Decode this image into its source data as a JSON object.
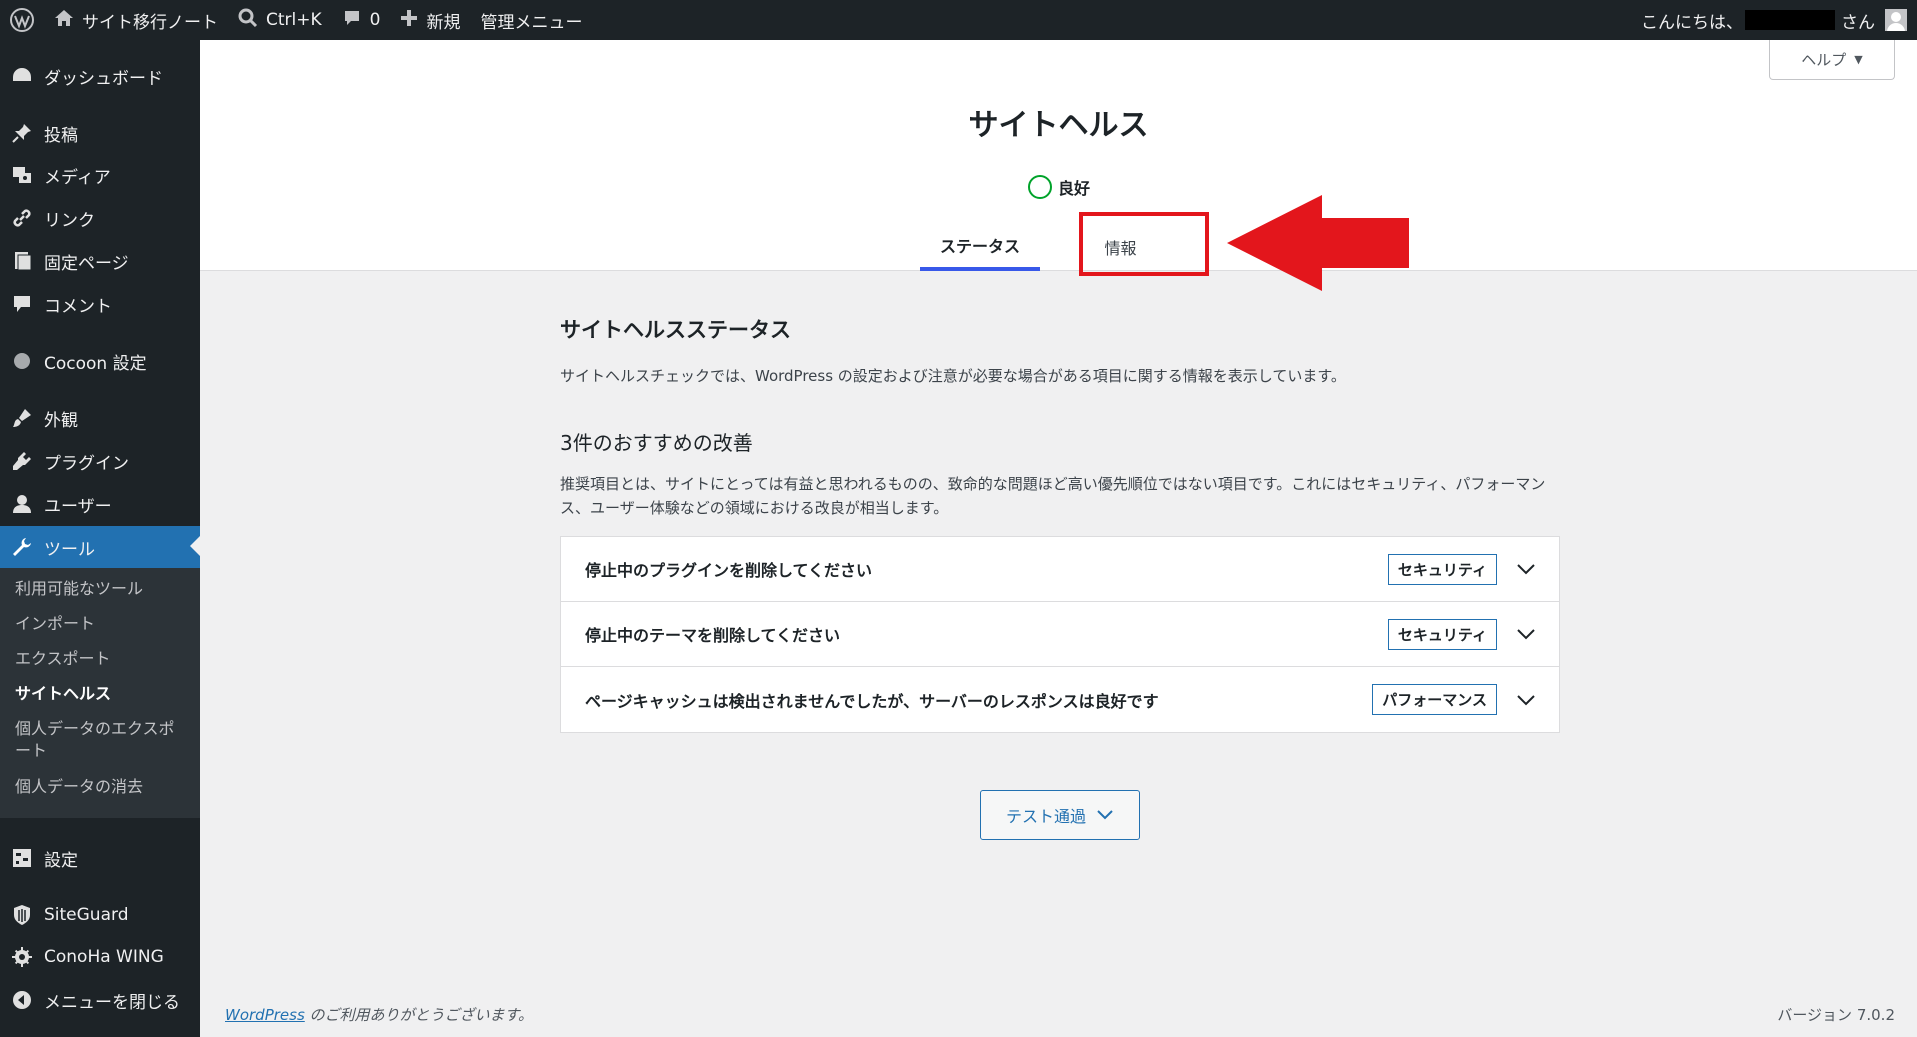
{
  "adminbar": {
    "site_name": "サイト移行ノート",
    "search_shortcut": "Ctrl+K",
    "comments_count": "0",
    "new_label": "新規",
    "admin_menu_label": "管理メニュー",
    "greeting": "こんにちは、",
    "greeting_suffix": "さん"
  },
  "sidebar": {
    "items": [
      {
        "label": "ダッシュボード",
        "icon": "dashboard-icon"
      },
      {
        "label": "投稿",
        "icon": "pin-icon"
      },
      {
        "label": "メディア",
        "icon": "media-icon"
      },
      {
        "label": "リンク",
        "icon": "link-icon"
      },
      {
        "label": "固定ページ",
        "icon": "page-icon"
      },
      {
        "label": "コメント",
        "icon": "comment-icon"
      },
      {
        "label": "Cocoon 設定",
        "icon": "circle-icon"
      },
      {
        "label": "外観",
        "icon": "brush-icon"
      },
      {
        "label": "プラグイン",
        "icon": "plugin-icon"
      },
      {
        "label": "ユーザー",
        "icon": "user-icon"
      },
      {
        "label": "ツール",
        "icon": "wrench-icon"
      },
      {
        "label": "設定",
        "icon": "settings-icon"
      },
      {
        "label": "SiteGuard",
        "icon": "shield-icon"
      },
      {
        "label": "ConoHa WING",
        "icon": "gear-icon"
      },
      {
        "label": "メニューを閉じる",
        "icon": "collapse-icon"
      }
    ],
    "submenu": [
      "利用可能なツール",
      "インポート",
      "エクスポート",
      "サイトヘルス",
      "個人データのエクスポート",
      "個人データの消去"
    ]
  },
  "header": {
    "help_label": "ヘルプ",
    "title": "サイトヘルス",
    "status_label": "良好",
    "tabs": [
      {
        "label": "ステータス"
      },
      {
        "label": "情報"
      }
    ]
  },
  "main": {
    "section_title": "サイトヘルスステータス",
    "section_desc": "サイトヘルスチェックでは、WordPress の設定および注意が必要な場合がある項目に関する情報を表示しています。",
    "rec_title": "3件のおすすめの改善",
    "rec_desc": "推奨項目とは、サイトにとっては有益と思われるものの、致命的な問題ほど高い優先順位ではない項目です。これにはセキュリティ、パフォーマンス、ユーザー体験などの領域における改良が相当します。",
    "issues": [
      {
        "title": "停止中のプラグインを削除してください",
        "badge": "セキュリティ"
      },
      {
        "title": "停止中のテーマを削除してください",
        "badge": "セキュリティ"
      },
      {
        "title": "ページキャッシュは検出されませんでしたが、サーバーのレスポンスは良好です",
        "badge": "パフォーマンス"
      }
    ],
    "passed_label": "テスト通過"
  },
  "footer": {
    "wp_link": "WordPress",
    "thanks": " のご利用ありがとうございます。",
    "version": "バージョン 7.0.2"
  },
  "colors": {
    "accent": "#2271b1",
    "good": "#00a32a",
    "annotation": "#e3161c"
  }
}
